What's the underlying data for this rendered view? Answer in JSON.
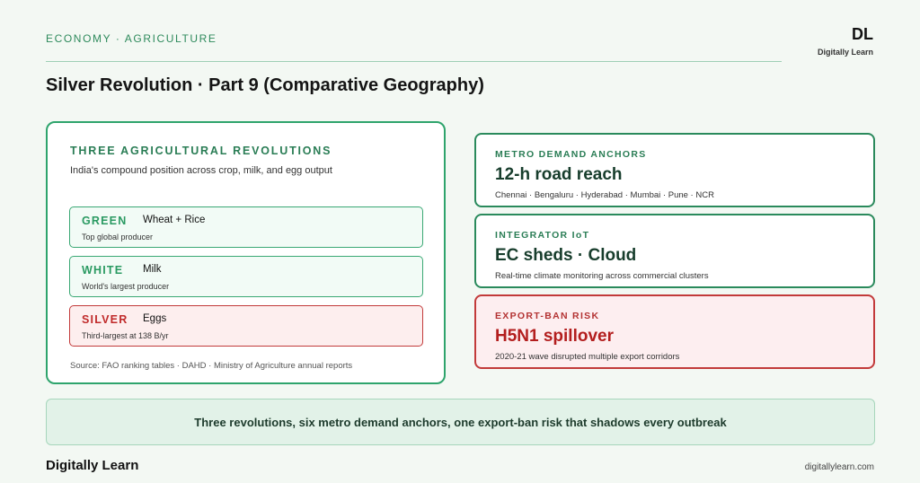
{
  "header": {
    "kicker": "ECONOMY · AGRICULTURE",
    "logo_mark": "DL",
    "logo_sub": "Digitally Learn",
    "title": "Silver Revolution · Part 9 (Comparative Geography)"
  },
  "revolutions_panel": {
    "title": "THREE AGRICULTURAL REVOLUTIONS",
    "subtitle": "India's compound position across crop, milk, and egg output",
    "items": [
      {
        "name": "GREEN",
        "crop": "Wheat + Rice",
        "desc": "Top global producer"
      },
      {
        "name": "WHITE",
        "crop": "Milk",
        "desc": "World's largest producer"
      },
      {
        "name": "SILVER",
        "crop": "Eggs",
        "desc": "Third-largest at 138 B/yr"
      }
    ],
    "source": "Source: FAO ranking tables · DAHD · Ministry of Agriculture annual reports"
  },
  "cards": [
    {
      "label": "METRO DEMAND ANCHORS",
      "value": "12-h road reach",
      "desc": "Chennai · Bengaluru · Hyderabad · Mumbai · Pune · NCR"
    },
    {
      "label": "INTEGRATOR IoT",
      "value": "EC sheds · Cloud",
      "desc": "Real-time climate monitoring across commercial clusters"
    },
    {
      "label": "EXPORT-BAN RISK",
      "value": "H5N1 spillover",
      "desc": "2020-21 wave disrupted multiple export corridors"
    }
  ],
  "banner": "Three revolutions, six metro demand anchors, one export-ban risk that shadows every outbreak",
  "footer": {
    "brand": "Digitally Learn",
    "url": "digitallylearn.com"
  },
  "colors": {
    "accent_green": "#2ea46c",
    "risk_red": "#c23a3a",
    "background": "#f3f8f3"
  }
}
